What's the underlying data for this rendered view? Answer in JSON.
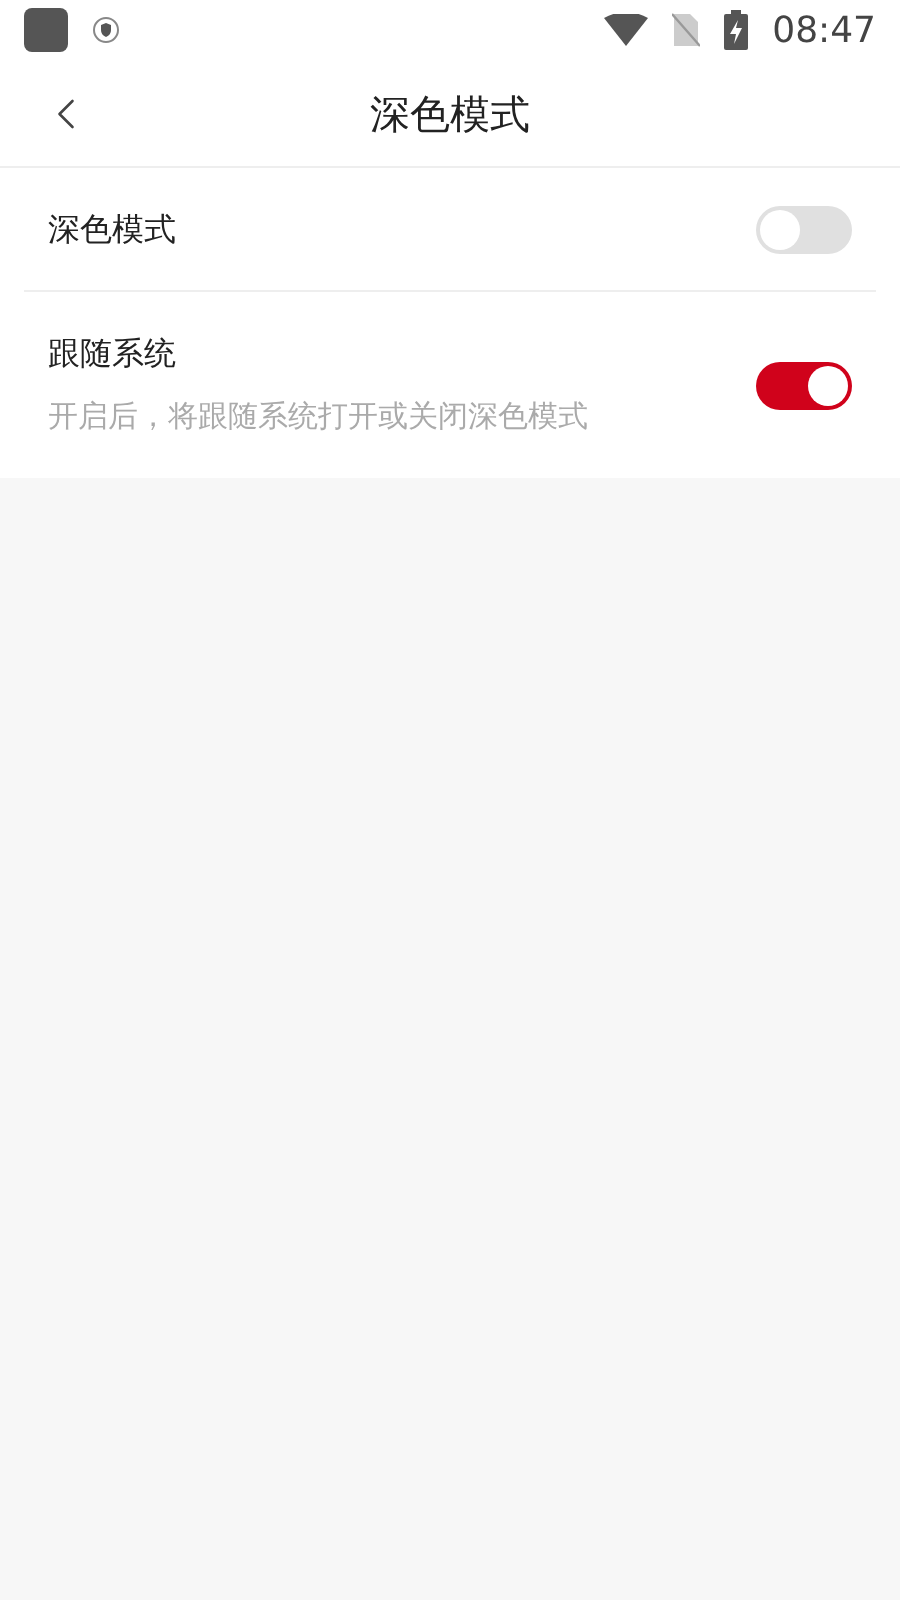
{
  "status_bar": {
    "time": "08:47"
  },
  "header": {
    "title": "深色模式"
  },
  "settings": [
    {
      "label": "深色模式",
      "on": false
    },
    {
      "label": "跟随系统",
      "description": "开启后，将跟随系统打开或关闭深色模式",
      "on": true
    }
  ]
}
